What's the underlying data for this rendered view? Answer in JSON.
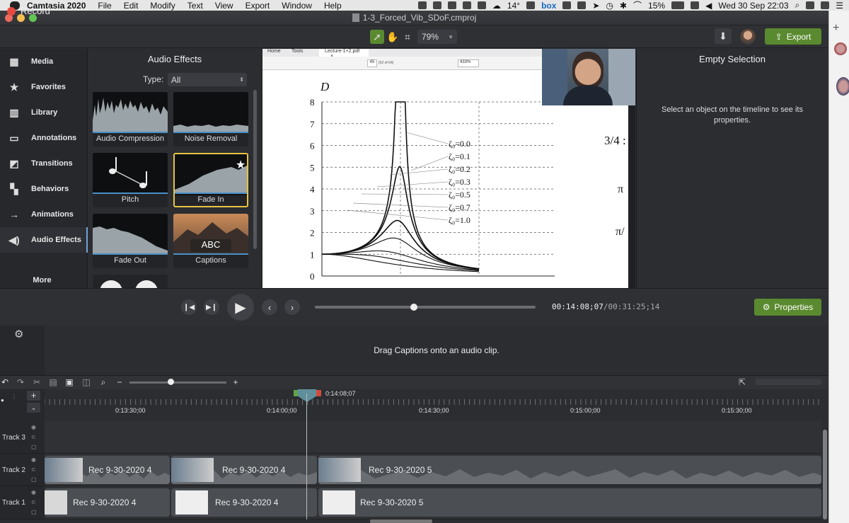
{
  "menubar": {
    "app": "Camtasia 2020",
    "items": [
      "File",
      "Edit",
      "Modify",
      "Text",
      "View",
      "Export",
      "Window",
      "Help"
    ],
    "temp": "14°",
    "app_box": "box",
    "battery": "15%",
    "datetime": "Wed 30 Sep  22:03"
  },
  "window": {
    "title": "1-3_Forced_Vib_SDoF.cmproj"
  },
  "toolbar": {
    "record_label": "Record",
    "zoom": "79%",
    "export_label": "Export"
  },
  "sidebar": {
    "items": [
      {
        "label": "Media",
        "icon": "film-icon"
      },
      {
        "label": "Favorites",
        "icon": "star-icon"
      },
      {
        "label": "Library",
        "icon": "library-icon"
      },
      {
        "label": "Annotations",
        "icon": "annotation-icon"
      },
      {
        "label": "Transitions",
        "icon": "transition-icon"
      },
      {
        "label": "Behaviors",
        "icon": "behaviors-icon"
      },
      {
        "label": "Animations",
        "icon": "animation-arrow-icon"
      },
      {
        "label": "Audio Effects",
        "icon": "speaker-icon"
      }
    ],
    "more_label": "More"
  },
  "audio_effects": {
    "title": "Audio Effects",
    "type_label": "Type:",
    "type_value": "All",
    "tiles": [
      {
        "label": "Audio Compression"
      },
      {
        "label": "Noise Removal"
      },
      {
        "label": "Pitch"
      },
      {
        "label": "Fade In"
      },
      {
        "label": "Fade Out"
      },
      {
        "label": "Captions",
        "overlay": "ABC"
      }
    ]
  },
  "canvas": {
    "pdf_tab_home": "Home",
    "pdf_tab_tools": "Tools",
    "pdf_doc_tab": "Lecture-1+2.pdf",
    "pdf_page": "45",
    "pdf_page_of": "(62 of 64)",
    "pdf_zoom": "433%",
    "plot_ylabel": "D",
    "y_ticks": [
      "0",
      "1",
      "2",
      "3",
      "4",
      "5",
      "6",
      "7",
      "8"
    ],
    "zeta_labels": [
      "ζ₀=0.0",
      "ζ₀=0.1",
      "ζ₀=0.2",
      "ζ₀=0.3",
      "ζ₀=0.5",
      "ζ₀=0.7",
      "ζ₀=1.0"
    ],
    "side_text_1": "3/4 :",
    "side_text_2": "π",
    "side_text_3": "π/"
  },
  "chart_data": {
    "type": "line",
    "ylabel": "D",
    "ylim": [
      0,
      8
    ],
    "xlim": [
      0,
      2
    ],
    "series": [
      {
        "name": "ζ0=0.0",
        "peak": 8
      },
      {
        "name": "ζ0=0.1",
        "peak": 5
      },
      {
        "name": "ζ0=0.2",
        "peak": 2.5
      },
      {
        "name": "ζ0=0.3",
        "peak": 1.7
      },
      {
        "name": "ζ0=0.5",
        "peak": 1.15
      },
      {
        "name": "ζ0=0.7",
        "peak": 1.0
      },
      {
        "name": "ζ0=1.0",
        "peak": 1.0
      }
    ]
  },
  "properties": {
    "title": "Empty Selection",
    "message": "Select an object on the timeline to see its properties.",
    "button": "Properties"
  },
  "playback": {
    "time_current": "00:14:08;07",
    "time_total": "/00:31:25;14"
  },
  "captions": {
    "message": "Drag Captions onto an audio clip."
  },
  "timeline": {
    "playhead_time": "0:14:08;07",
    "ruler": [
      "0:13:30;00",
      "0:14:00;00",
      "0:14:30;00",
      "0:15:00;00",
      "0:15:30;00"
    ],
    "tracks": [
      {
        "name": "Track 3",
        "clips": []
      },
      {
        "name": "Track 2",
        "clips": [
          "Rec 9-30-2020 4",
          "Rec 9-30-2020 4",
          "Rec 9-30-2020 5"
        ]
      },
      {
        "name": "Track 1",
        "clips": [
          "Rec 9-30-2020 4",
          "Rec 9-30-2020 4",
          "Rec 9-30-2020 5"
        ]
      }
    ]
  }
}
